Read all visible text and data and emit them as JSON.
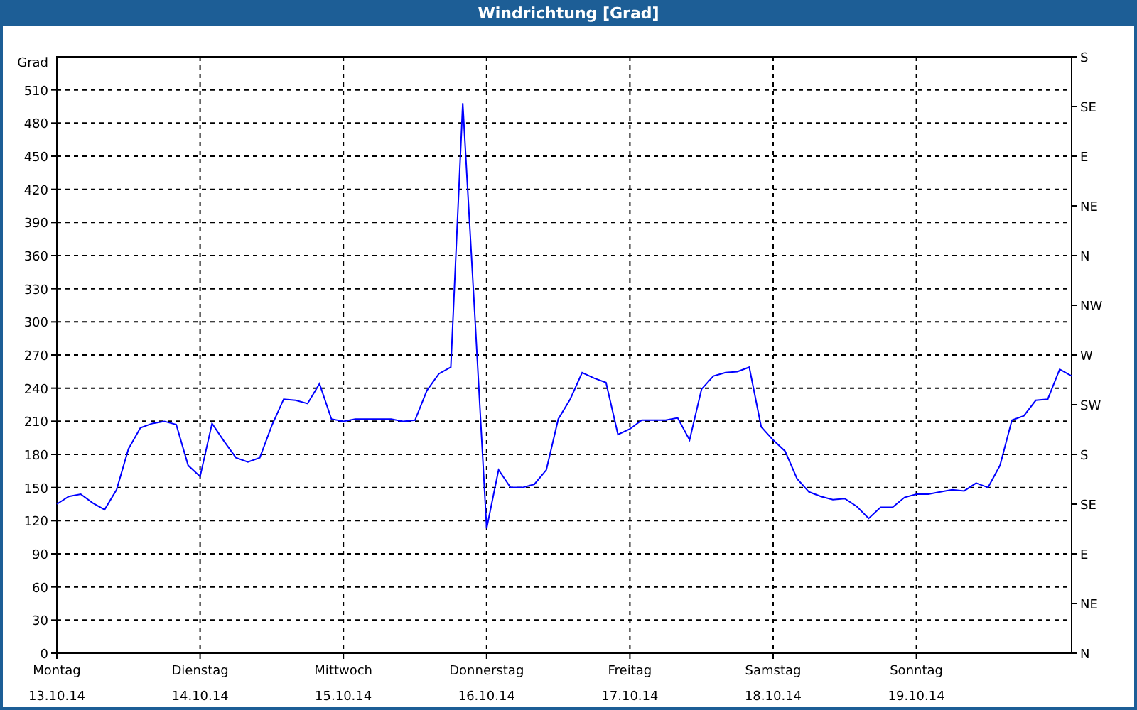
{
  "window": {
    "title": "Windrichtung [Grad]"
  },
  "chart": {
    "right_axis_labels": [
      "S",
      "SE",
      "E",
      "NE",
      "N",
      "NW",
      "W",
      "SW",
      "S",
      "SE",
      "E",
      "NE",
      "N"
    ],
    "day_labels": [
      "Montag",
      "Dienstag",
      "Mittwoch",
      "Donnerstag",
      "Freitag",
      "Samstag",
      "Sonntag"
    ],
    "chart_data": {
      "type": "line",
      "ylabel": "Grad",
      "grid": true,
      "ylim": [
        0,
        540
      ],
      "yticks": [
        0,
        30,
        60,
        90,
        120,
        150,
        180,
        210,
        240,
        270,
        300,
        330,
        360,
        390,
        420,
        450,
        480,
        510
      ],
      "categories": [
        "13.10.14",
        null,
        null,
        null,
        null,
        null,
        null,
        null,
        null,
        null,
        null,
        null,
        "14.10.14",
        null,
        null,
        null,
        null,
        null,
        null,
        null,
        null,
        null,
        null,
        null,
        "15.10.14",
        null,
        null,
        null,
        null,
        null,
        null,
        null,
        null,
        null,
        null,
        null,
        "16.10.14",
        null,
        null,
        null,
        null,
        null,
        null,
        null,
        null,
        null,
        null,
        null,
        "17.10.14",
        null,
        null,
        null,
        null,
        null,
        null,
        null,
        null,
        null,
        null,
        null,
        "18.10.14",
        null,
        null,
        null,
        null,
        null,
        null,
        null,
        null,
        null,
        null,
        null,
        "19.10.14",
        null,
        null,
        null,
        null,
        null,
        null,
        null,
        null,
        null,
        null,
        null,
        null,
        null
      ],
      "series": [
        {
          "color": "#0000ff",
          "values": [
            135,
            142,
            144,
            136,
            130,
            148,
            185,
            204,
            208,
            210,
            207,
            170,
            160,
            208,
            192,
            177,
            173,
            177,
            206,
            230,
            229,
            226,
            244,
            212,
            210,
            212,
            212,
            212,
            212,
            210,
            211,
            238,
            253,
            259,
            498,
            308,
            113,
            166,
            150,
            150,
            153,
            166,
            212,
            230,
            254,
            249,
            245,
            198,
            203,
            211,
            211,
            211,
            213,
            193,
            239,
            251,
            254,
            255,
            259,
            205,
            193,
            183,
            158,
            146,
            142,
            139,
            140,
            133,
            122,
            132,
            132,
            141,
            144,
            144,
            146,
            148,
            147,
            154,
            150,
            170,
            211,
            215,
            229,
            230,
            257,
            251
          ]
        }
      ]
    }
  }
}
